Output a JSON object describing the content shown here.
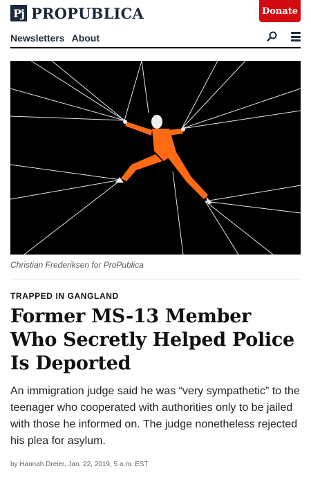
{
  "header": {
    "logo_mark": "Pj",
    "logo_text": "PROPUBLICA",
    "donate_label": "Donate"
  },
  "nav": {
    "items": [
      {
        "label": "Newsletters"
      },
      {
        "label": "About"
      }
    ],
    "icons": [
      "search-icon",
      "menu-icon"
    ]
  },
  "hero": {
    "caption": "Christian Frederiksen for ProPublica",
    "colors": {
      "background": "#000000",
      "figure": "#ff6a13",
      "lines": "#e8e8e8"
    }
  },
  "article": {
    "kicker": "TRAPPED IN GANGLAND",
    "headline": "Former MS-13 Member Who Secretly Helped Police Is Deported",
    "dek": "An immigration judge said he was “very sympathetic” to the teenager who cooperated with authorities only to be jailed with those he informed on. The judge nonetheless rejected his plea for asylum.",
    "byline": "by Hannah Dreier, Jan. 22, 2019, 5 a.m. EST"
  },
  "colors": {
    "brand": "#1a2a3a",
    "donate": "#d20a11"
  }
}
